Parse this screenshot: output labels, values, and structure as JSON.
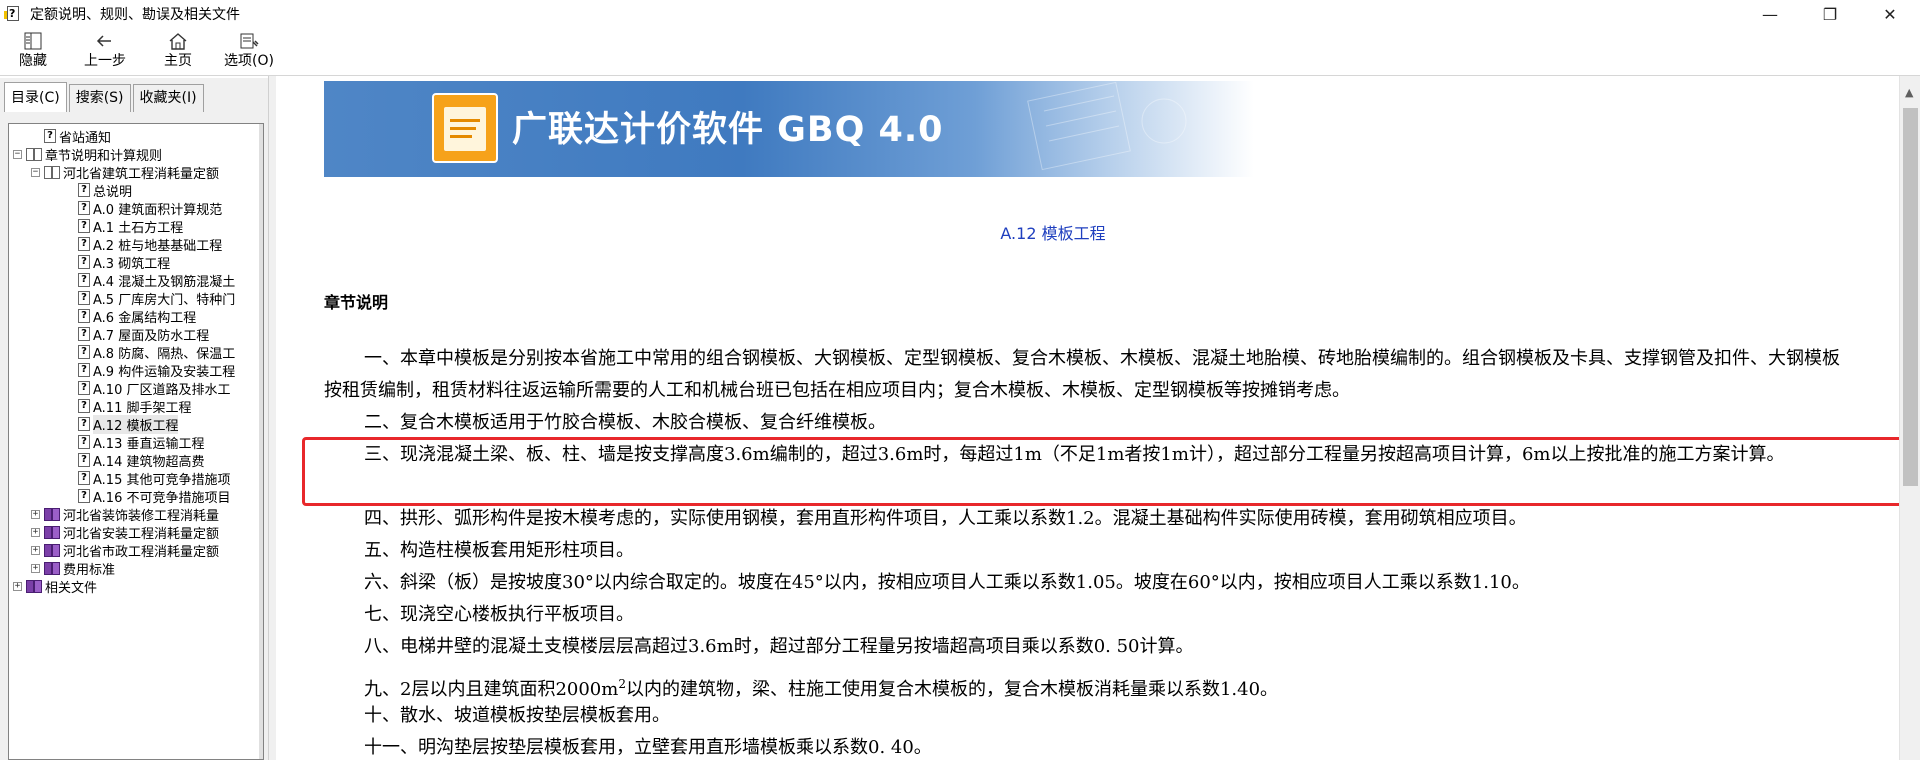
{
  "window": {
    "title": "定额说明、规则、勘误及相关文件",
    "icon": "help-doc-icon",
    "controls": {
      "minimize": "—",
      "maximize": "❐",
      "close": "✕"
    }
  },
  "toolbar": {
    "buttons": [
      {
        "label": "隐藏",
        "icon": "hide-pane-icon"
      },
      {
        "label": "上一步",
        "icon": "back-arrow-icon"
      },
      {
        "label": "主页",
        "icon": "home-icon"
      },
      {
        "label": "选项(O)",
        "icon": "options-icon"
      }
    ]
  },
  "left_pane": {
    "tabs": [
      {
        "label": "目录(C)",
        "active": true
      },
      {
        "label": "搜索(S)",
        "active": false
      },
      {
        "label": "收藏夹(I)",
        "active": false
      }
    ],
    "tree": [
      {
        "label": "省站通知",
        "indent": 1,
        "icon": "topic",
        "expander": ""
      },
      {
        "label": "章节说明和计算规则",
        "indent": 0,
        "icon": "book-open",
        "expander": "−"
      },
      {
        "label": "河北省建筑工程消耗量定额",
        "indent": 1,
        "icon": "book-open",
        "expander": "−"
      },
      {
        "label": "总说明",
        "indent": 2,
        "icon": "topic",
        "expander": ""
      },
      {
        "label": "A.0 建筑面积计算规范",
        "indent": 2,
        "icon": "topic",
        "expander": ""
      },
      {
        "label": "A.1 土石方工程",
        "indent": 2,
        "icon": "topic",
        "expander": ""
      },
      {
        "label": "A.2 桩与地基基础工程",
        "indent": 2,
        "icon": "topic",
        "expander": ""
      },
      {
        "label": "A.3 砌筑工程",
        "indent": 2,
        "icon": "topic",
        "expander": ""
      },
      {
        "label": "A.4 混凝土及钢筋混凝土",
        "indent": 2,
        "icon": "topic",
        "expander": ""
      },
      {
        "label": "A.5 厂库房大门、特种门",
        "indent": 2,
        "icon": "topic",
        "expander": ""
      },
      {
        "label": "A.6 金属结构工程",
        "indent": 2,
        "icon": "topic",
        "expander": ""
      },
      {
        "label": "A.7 屋面及防水工程",
        "indent": 2,
        "icon": "topic",
        "expander": ""
      },
      {
        "label": "A.8 防腐、隔热、保温工",
        "indent": 2,
        "icon": "topic",
        "expander": ""
      },
      {
        "label": "A.9 构件运输及安装工程",
        "indent": 2,
        "icon": "topic",
        "expander": ""
      },
      {
        "label": "A.10 厂区道路及排水工",
        "indent": 2,
        "icon": "topic",
        "expander": ""
      },
      {
        "label": "A.11 脚手架工程",
        "indent": 2,
        "icon": "topic",
        "expander": ""
      },
      {
        "label": "A.12 模板工程",
        "indent": 2,
        "icon": "topic",
        "expander": "",
        "selected": true
      },
      {
        "label": "A.13 垂直运输工程",
        "indent": 2,
        "icon": "topic",
        "expander": ""
      },
      {
        "label": "A.14 建筑物超高费",
        "indent": 2,
        "icon": "topic",
        "expander": ""
      },
      {
        "label": "A.15 其他可竞争措施项",
        "indent": 2,
        "icon": "topic",
        "expander": ""
      },
      {
        "label": "A.16 不可竞争措施项目",
        "indent": 2,
        "icon": "topic",
        "expander": ""
      },
      {
        "label": "河北省装饰装修工程消耗量",
        "indent": 1,
        "icon": "book",
        "expander": "+"
      },
      {
        "label": "河北省安装工程消耗量定额",
        "indent": 1,
        "icon": "book",
        "expander": "+"
      },
      {
        "label": "河北省市政工程消耗量定额",
        "indent": 1,
        "icon": "book",
        "expander": "+"
      },
      {
        "label": "费用标准",
        "indent": 1,
        "icon": "book",
        "expander": "+"
      },
      {
        "label": "相关文件",
        "indent": 0,
        "icon": "book",
        "expander": "+"
      }
    ]
  },
  "content": {
    "banner_title": "广联达计价软件 GBQ 4.0",
    "chapter_title": "A.12 模板工程",
    "section_head": "章节说明",
    "paragraphs": [
      "一、本章中模板是分别按本省施工中常用的组合钢模板、大钢模板、定型钢模板、复合木模板、木模板、混凝土地胎模、砖地胎模编制的。组合钢模板及卡具、支撑钢管及扣件、大钢模板按租赁编制，租赁材料往返运输所需要的人工和机械台班已包括在相应项目内；复合木模板、木模板、定型钢模板等按摊销考虑。",
      "二、复合木模板适用于竹胶合模板、木胶合模板、复合纤维模板。",
      "三、现浇混凝土梁、板、柱、墙是按支撑高度3.6m编制的，超过3.6m时，每超过1m（不足1m者按1m计），超过部分工程量另按超高项目计算，6m以上按批准的施工方案计算。",
      "四、拱形、弧形构件是按木模考虑的，实际使用钢模，套用直形构件项目，人工乘以系数1.2。混凝土基础构件实际使用砖模，套用砌筑相应项目。",
      "五、构造柱模板套用矩形柱项目。",
      "六、斜梁（板）是按坡度30°以内综合取定的。坡度在45°以内，按相应项目人工乘以系数1.05。坡度在60°以内，按相应项目人工乘以系数1.10。",
      "七、现浇空心楼板执行平板项目。",
      "八、电梯井壁的混凝土支模楼层层高超过3.6m时，超过部分工程量另按墙超高项目乘以系数0. 50计算。",
      "十、散水、坡道模板按垫层模板套用。",
      "十一、明沟垫层按垫层模板套用，立壁套用直形墙模板乘以系数0. 40。"
    ],
    "para9": {
      "before": "九、2层以内且建筑面积2000m",
      "sup": "2",
      "after": "以内的建筑物，梁、柱施工使用复合木模板的，复合木模板消耗量乘以系数1.40。"
    }
  },
  "colors": {
    "highlight_border": "#e8282b",
    "chapter_title": "#1f3fbf",
    "banner": "#4f86c6"
  }
}
